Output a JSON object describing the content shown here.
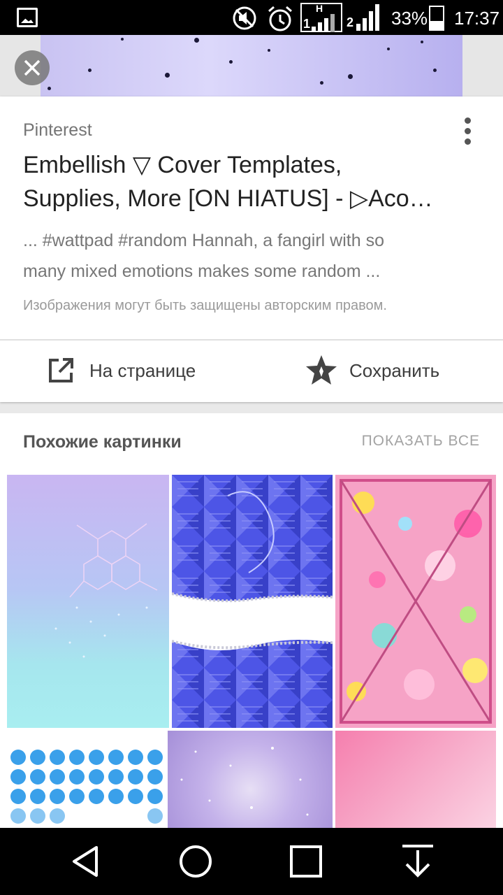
{
  "status_bar": {
    "battery_percent": "33%",
    "time": "17:37",
    "network_label": "H",
    "sim1": "1",
    "sim2": "2"
  },
  "card": {
    "source": "Pinterest",
    "title": "Embellish ▽ Cover Templates,\nSupplies, More [ON HIATUS] - ▷Aco…",
    "description": "... #wattpad #random Hannah, a fangirl with so\nmany mixed emotions makes some random ...",
    "copyright_notice": "Изображения могут быть защищены авторским правом.",
    "actions": {
      "open_page": "На странице",
      "save": "Сохранить"
    }
  },
  "similar": {
    "title": "Похожие картинки",
    "show_all": "ПОКАЗАТЬ ВСЕ"
  },
  "icons": {
    "gallery": "gallery-icon",
    "mute": "mute-icon",
    "alarm": "alarm-icon",
    "close": "close-icon",
    "more": "more-vert-icon",
    "open_external": "open-external-icon",
    "save_star": "star-icon",
    "back": "back-icon",
    "home": "home-icon",
    "recents": "recents-icon",
    "download": "download-icon"
  },
  "colors": {
    "accent_gray": "#757575",
    "title_text": "#222222"
  }
}
